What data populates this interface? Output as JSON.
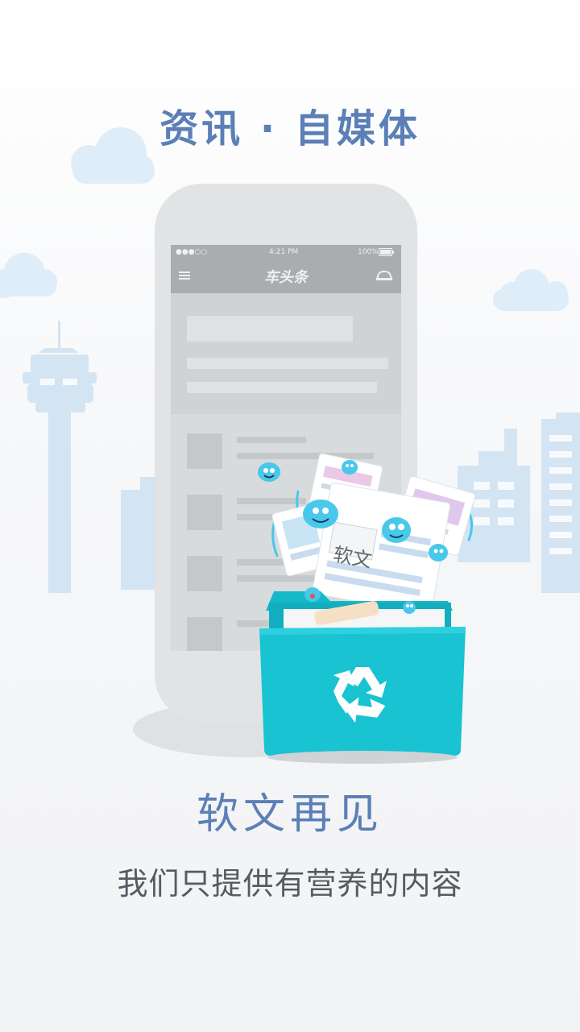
{
  "header": {
    "title": "资讯 · 自媒体"
  },
  "phone_screen": {
    "status_time": "4:21 PM",
    "status_battery": "100%",
    "app_logo": "车头条"
  },
  "illustration": {
    "card_label": "软文"
  },
  "main": {
    "heading": "软文再见",
    "subheading": "我们只提供有营养的内容"
  },
  "colors": {
    "title": "#5b7fb6",
    "bin": "#19c3d2",
    "cloud": "#deedf8",
    "buildings": "#d3e4f3",
    "mascot": "#48c8ea"
  },
  "icons": [
    "cloud-icon",
    "tower-icon",
    "building-icon",
    "menu-icon",
    "car-icon",
    "recycle-icon",
    "mascot-icon"
  ]
}
